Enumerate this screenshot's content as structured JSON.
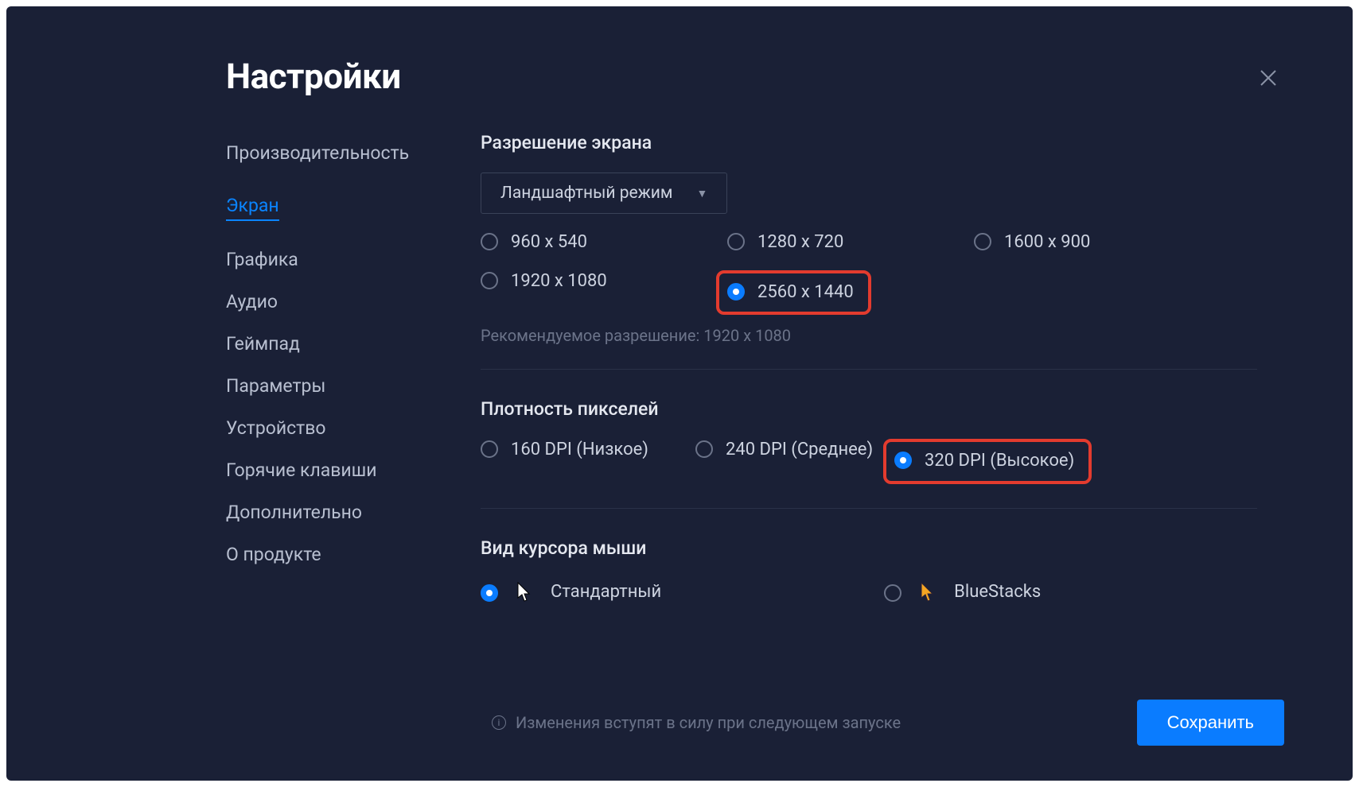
{
  "title": "Настройки",
  "sidebar": {
    "items": [
      {
        "label": "Производительность"
      },
      {
        "label": "Экран"
      },
      {
        "label": "Графика"
      },
      {
        "label": "Аудио"
      },
      {
        "label": "Геймпад"
      },
      {
        "label": "Параметры"
      },
      {
        "label": "Устройство"
      },
      {
        "label": "Горячие клавиши"
      },
      {
        "label": "Дополнительно"
      },
      {
        "label": "О продукте"
      }
    ],
    "active_index": 1
  },
  "resolution": {
    "title": "Разрешение экрана",
    "mode_label": "Ландшафтный режим",
    "options": [
      {
        "label": "960 x 540"
      },
      {
        "label": "1280 x 720"
      },
      {
        "label": "1600 x 900"
      },
      {
        "label": "1920 x 1080"
      },
      {
        "label": "2560 x 1440"
      }
    ],
    "selected_index": 4,
    "hint": "Рекомендуемое разрешение: 1920 x 1080"
  },
  "dpi": {
    "title": "Плотность пикселей",
    "options": [
      {
        "label": "160 DPI (Низкое)"
      },
      {
        "label": "240 DPI (Среднее)"
      },
      {
        "label": "320 DPI (Высокое)"
      }
    ],
    "selected_index": 2
  },
  "cursor": {
    "title": "Вид курсора мыши",
    "options": [
      {
        "label": "Стандартный"
      },
      {
        "label": "BlueStacks"
      }
    ],
    "selected_index": 0
  },
  "footer": {
    "note": "Изменения вступят в силу при следующем запуске",
    "save_label": "Сохранить"
  }
}
